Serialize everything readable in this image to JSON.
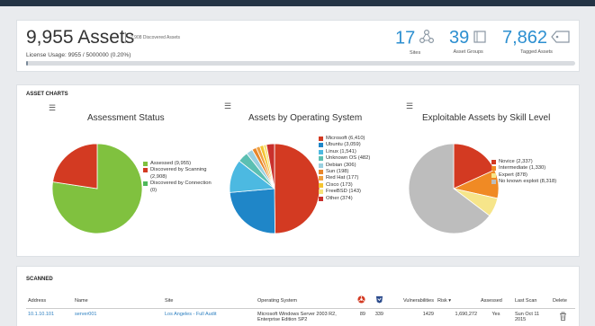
{
  "summary": {
    "assets_title": "9,955 Assets",
    "discovered_assets": "2,908 Discovered Assets",
    "license_usage": "License Usage: 9955 / 5000000 (0.20%)",
    "license_fraction": 0.002,
    "stats": [
      {
        "value": "17",
        "label": "Sites",
        "icon": "sites-icon"
      },
      {
        "value": "39",
        "label": "Asset Groups",
        "icon": "asset-groups-icon"
      },
      {
        "value": "7,862",
        "label": "Tagged Assets",
        "icon": "tag-icon"
      }
    ]
  },
  "charts_section": {
    "title": "ASSET CHARTS",
    "menu_icon": "menu-icon"
  },
  "chart_data": [
    {
      "type": "pie",
      "title": "Assessment Status",
      "legend_position": "right",
      "slices": [
        {
          "label": "Assessed (9,955)",
          "value": 9955,
          "color": "#80c13f"
        },
        {
          "label": "Discovered by Scanning (2,908)",
          "value": 2908,
          "color": "#d33a22"
        },
        {
          "label": "Discovered by Connection (0)",
          "value": 0,
          "color": "#4fb85a"
        }
      ]
    },
    {
      "type": "pie",
      "title": "Assets by Operating System",
      "legend_position": "right",
      "slices": [
        {
          "label": "Microsoft (6,410)",
          "value": 6410,
          "color": "#d33a22"
        },
        {
          "label": "Ubuntu (3,059)",
          "value": 3059,
          "color": "#1f86c8"
        },
        {
          "label": "Linux (1,541)",
          "value": 1541,
          "color": "#4cb9e1"
        },
        {
          "label": "Unknown OS (482)",
          "value": 482,
          "color": "#5bbfb2"
        },
        {
          "label": "Debian (306)",
          "value": 306,
          "color": "#9ad0e0"
        },
        {
          "label": "Sun (198)",
          "value": 198,
          "color": "#e8862a"
        },
        {
          "label": "Red Hat (177)",
          "value": 177,
          "color": "#f0a040"
        },
        {
          "label": "Cisco (173)",
          "value": 173,
          "color": "#f4c430"
        },
        {
          "label": "FreeBSD (143)",
          "value": 143,
          "color": "#f6e27a"
        },
        {
          "label": "Other (374)",
          "value": 374,
          "color": "#c9302c"
        }
      ]
    },
    {
      "type": "pie",
      "title": "Exploitable Assets by Skill Level",
      "legend_position": "right",
      "slices": [
        {
          "label": "Novice (2,337)",
          "value": 2337,
          "color": "#d33a22"
        },
        {
          "label": "Intermediate (1,330)",
          "value": 1330,
          "color": "#f08a24"
        },
        {
          "label": "Expert (878)",
          "value": 878,
          "color": "#f6e58a"
        },
        {
          "label": "No known exploit (8,318)",
          "value": 8318,
          "color": "#bdbdbd"
        }
      ]
    }
  ],
  "scanned": {
    "title": "SCANNED",
    "columns": [
      "Address",
      "Name",
      "Site",
      "Operating System",
      "",
      "",
      "Vulnerabilities",
      "Risk",
      "Assessed",
      "Last Scan",
      "Delete"
    ],
    "sort_indicator": "▾",
    "rows": [
      {
        "address": "10.1.10.101",
        "name": "server001",
        "site": "Los Angeles - Full Audit",
        "os": "Microsoft Windows Server 2003 R2, Enterprise Edition SP2",
        "malware": "89",
        "exploits": "339",
        "vulnerabilities": "1429",
        "risk": "1,690,272",
        "assessed": "Yes",
        "last_scan": "Sun Oct 11 2015"
      }
    ]
  }
}
